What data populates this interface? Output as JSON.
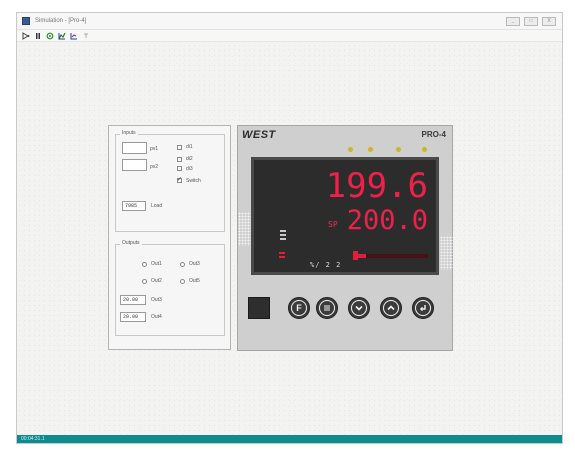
{
  "window": {
    "title": "Simulation - [Pro-4]",
    "controls": [
      "_",
      "□",
      "X"
    ]
  },
  "toolbar": {
    "icons": [
      "run-icon",
      "pause-icon",
      "reset-icon",
      "chart-icon",
      "trend-icon",
      "help-icon"
    ]
  },
  "inputs": {
    "group_title": "Inputs",
    "pv1_unit": "pv1",
    "pv2_unit": "pv2",
    "alarm_labels": [
      "di1",
      "di2",
      "di3"
    ],
    "switch_label": "Switch",
    "switch_checked": true,
    "load_value": "7985",
    "load_label": "Load"
  },
  "outputs": {
    "group_title": "Outputs",
    "radio_labels": [
      "Out1",
      "Out3",
      "Out2",
      "Out5"
    ],
    "field_rows": [
      {
        "value": "20.00",
        "label": "Out3"
      },
      {
        "value": "20.00",
        "label": "Out4"
      }
    ]
  },
  "device": {
    "brand": "WEST",
    "model": "PRO-4",
    "display_top": "199.6",
    "display_bottom": "200.0",
    "display_prefix": "SP",
    "units_text": "%/ 2 2",
    "bar_fill_percent": 14,
    "led_color": "#c7b53a",
    "lcd_color": "#f0204a"
  },
  "keys": [
    {
      "name": "blank-key"
    },
    {
      "name": "function-key",
      "glyph": "F"
    },
    {
      "name": "auto-manual-key",
      "glyph": "≡"
    },
    {
      "name": "down-key",
      "glyph": "down"
    },
    {
      "name": "up-key",
      "glyph": "up"
    },
    {
      "name": "enter-key",
      "glyph": "enter"
    }
  ],
  "status": {
    "text": "00:04:31.1",
    "color": "#0e8b8e"
  }
}
